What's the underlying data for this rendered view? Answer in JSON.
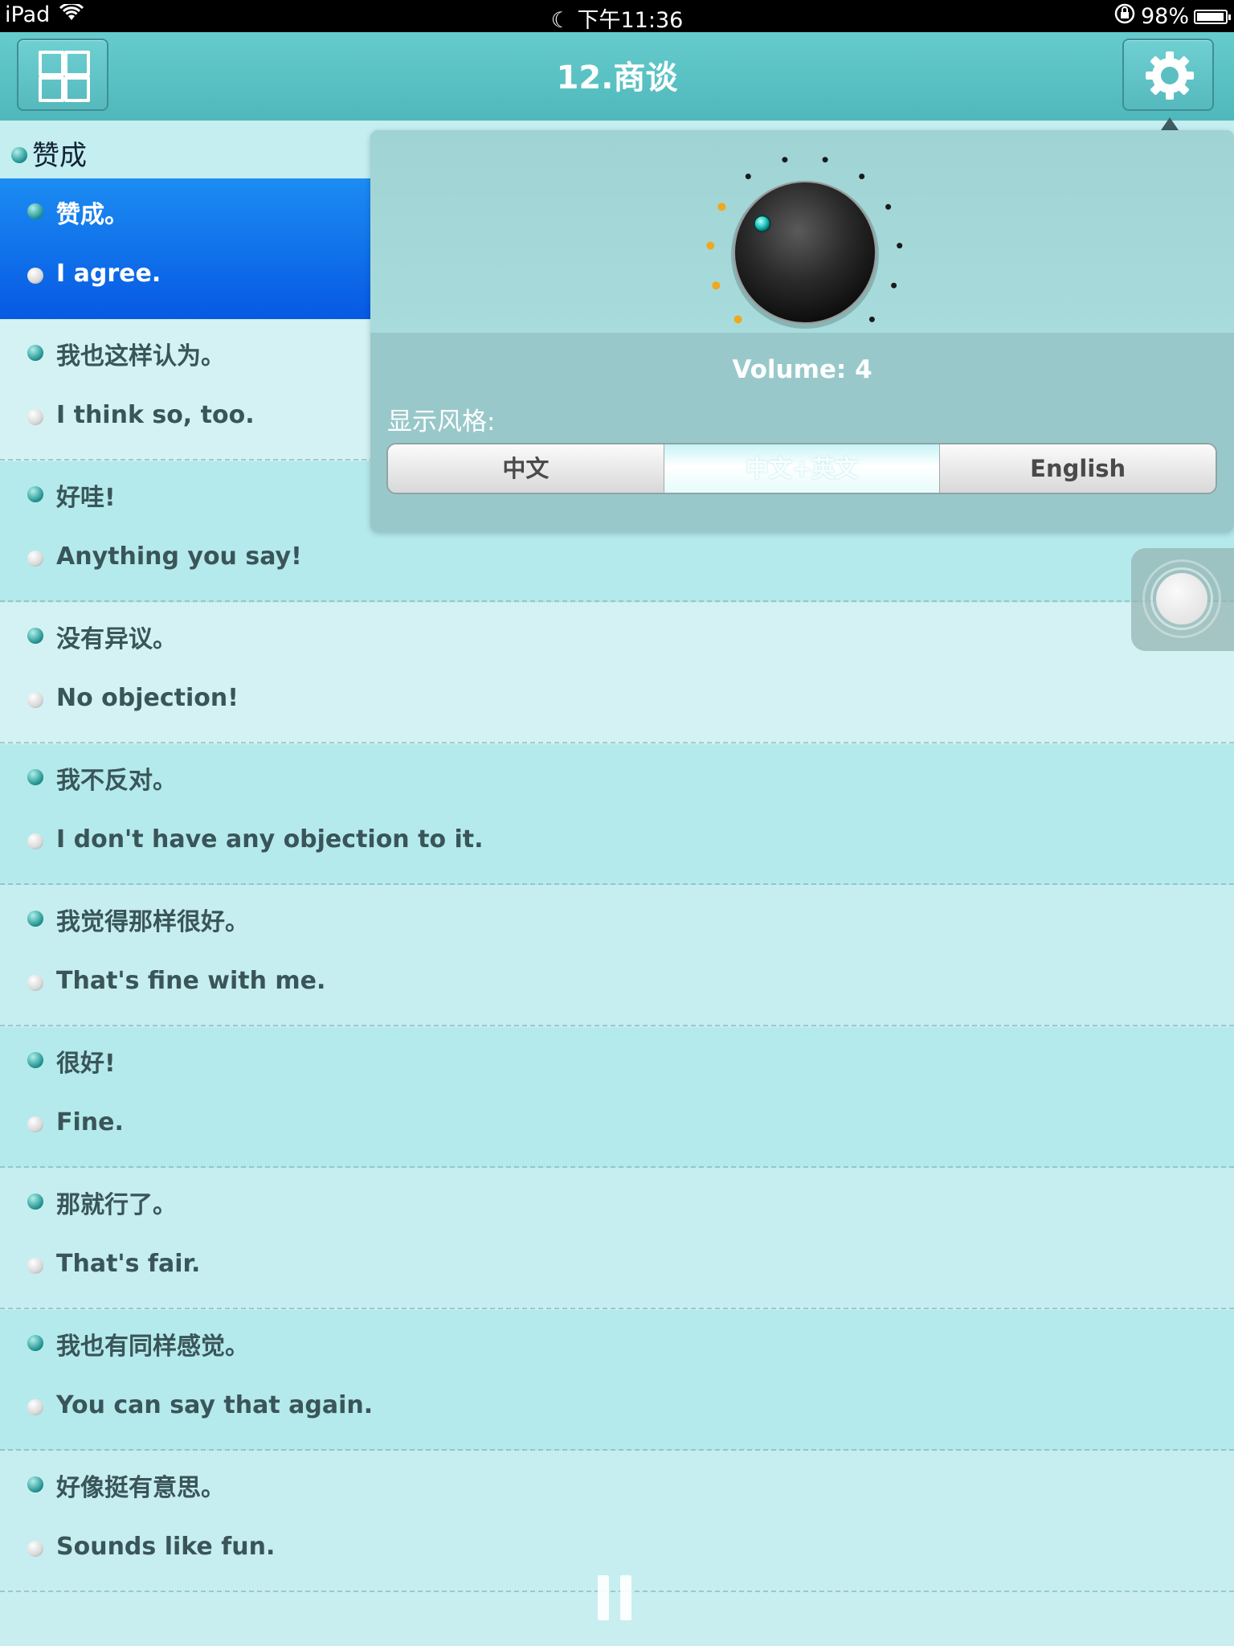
{
  "status_bar": {
    "device": "iPad",
    "time": "下午11:36",
    "battery": "98%",
    "battery_level": 0.98
  },
  "nav": {
    "title": "12.商谈"
  },
  "section": {
    "title": "赞成"
  },
  "rows": [
    {
      "zh": "赞成。",
      "en": "I agree."
    },
    {
      "zh": "我也这样认为。",
      "en": "I think so, too."
    },
    {
      "zh": "好哇!",
      "en": "Anything you say!"
    },
    {
      "zh": "没有异议。",
      "en": "No objection!"
    },
    {
      "zh": "我不反对。",
      "en": "I don't have any objection to it."
    },
    {
      "zh": "我觉得那样很好。",
      "en": "That's fine with me."
    },
    {
      "zh": "很好!",
      "en": "Fine."
    },
    {
      "zh": "那就行了。",
      "en": "That's fair."
    },
    {
      "zh": "我也有同样感觉。",
      "en": "You can say that again."
    },
    {
      "zh": "好像挺有意思。",
      "en": "Sounds like fun."
    }
  ],
  "selected_row": 0,
  "popover": {
    "volume_label": "Volume: 4",
    "volume_value": 4,
    "volume_max": 12,
    "style_label": "显示风格:",
    "segments": [
      "中文",
      "中文+英文",
      "English"
    ],
    "selected_segment": 1
  },
  "colors": {
    "nav_bar": "#55b9bd",
    "selected_row": "#0a66e8",
    "knob_lit_dot": "#f0a81e"
  }
}
